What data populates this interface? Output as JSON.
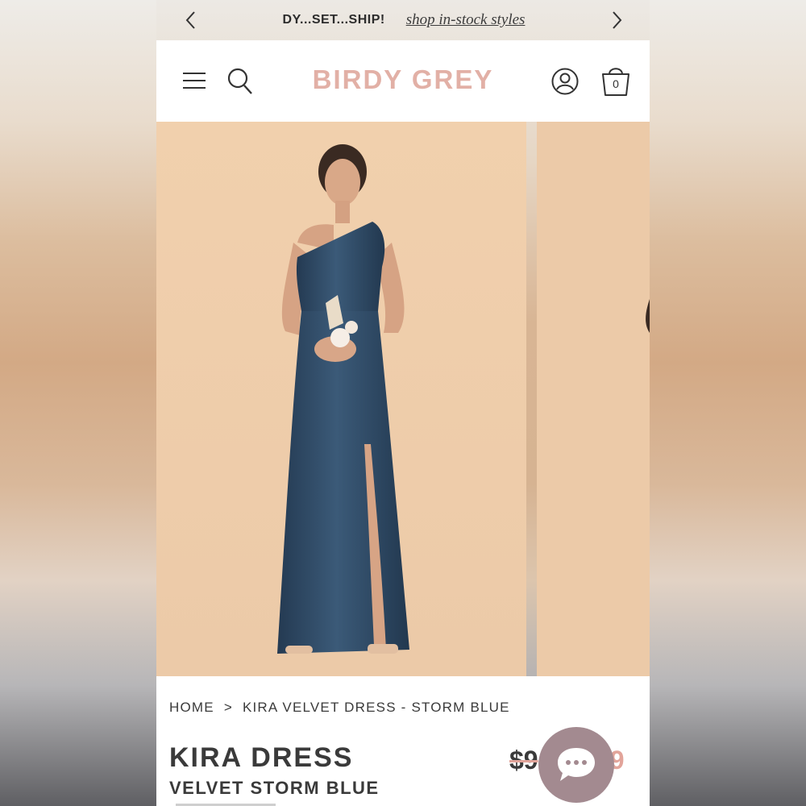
{
  "promo": {
    "message": "DY...SET...SHIP!",
    "link": "shop in-stock styles"
  },
  "header": {
    "logo": "BIRDY GREY",
    "cart_count": "0"
  },
  "breadcrumb": {
    "home": "HOME",
    "separator": ">",
    "current": "KIRA VELVET DRESS - STORM BLUE"
  },
  "product": {
    "title": "KIRA DRESS",
    "subtitle": "VELVET STORM BLUE",
    "price_original": "$9",
    "price_sale": "49"
  },
  "colors": {
    "brand": "#e2b0a6",
    "sale": "#e2a49a",
    "dress": "#2f4863",
    "backdrop": "#f0ceac",
    "chat": "#a38a90"
  },
  "icons": [
    "chevron-left-icon",
    "chevron-right-icon",
    "menu-icon",
    "search-icon",
    "account-icon",
    "shopping-bag-icon",
    "chat-icon"
  ]
}
